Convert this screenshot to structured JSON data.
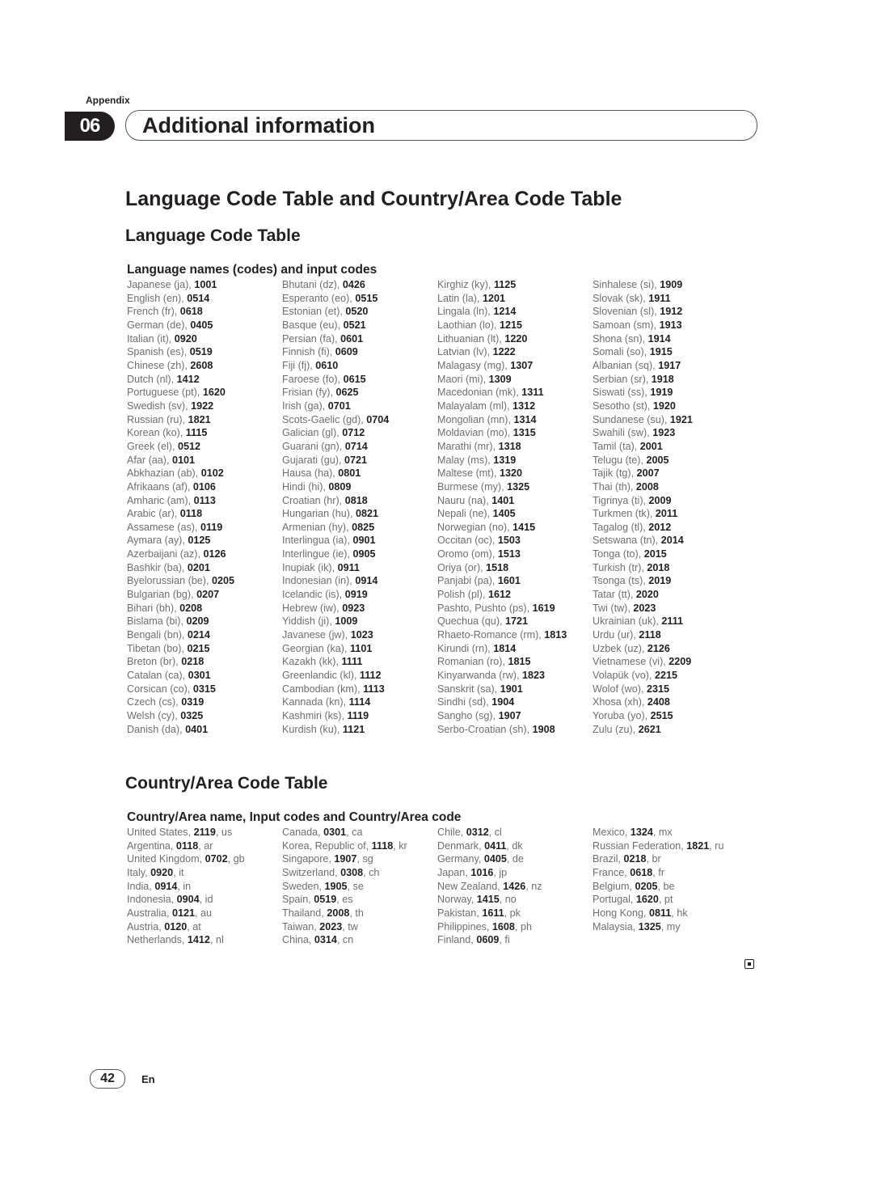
{
  "header": {
    "appendix_label": "Appendix",
    "chapter_number": "06",
    "chapter_title": "Additional information"
  },
  "main_title": "Language Code Table and Country/Area Code Table",
  "language_section": {
    "title": "Language Code Table",
    "subtitle": "Language names (codes) and input codes",
    "columns": [
      [
        {
          "name": "Japanese (ja), ",
          "code": "1001"
        },
        {
          "name": "English (en), ",
          "code": "0514"
        },
        {
          "name": "French (fr), ",
          "code": "0618"
        },
        {
          "name": "German (de), ",
          "code": "0405"
        },
        {
          "name": "Italian (it), ",
          "code": "0920"
        },
        {
          "name": "Spanish (es), ",
          "code": "0519"
        },
        {
          "name": "Chinese (zh), ",
          "code": "2608"
        },
        {
          "name": "Dutch (nl), ",
          "code": "1412"
        },
        {
          "name": "Portuguese (pt), ",
          "code": "1620"
        },
        {
          "name": "Swedish (sv), ",
          "code": "1922"
        },
        {
          "name": "Russian (ru), ",
          "code": "1821"
        },
        {
          "name": "Korean (ko), ",
          "code": "1115"
        },
        {
          "name": "Greek (el), ",
          "code": "0512"
        },
        {
          "name": "Afar (aa), ",
          "code": "0101"
        },
        {
          "name": "Abkhazian (ab), ",
          "code": "0102"
        },
        {
          "name": "Afrikaans (af), ",
          "code": "0106"
        },
        {
          "name": "Amharic (am), ",
          "code": "0113"
        },
        {
          "name": "Arabic (ar), ",
          "code": "0118"
        },
        {
          "name": "Assamese (as), ",
          "code": "0119"
        },
        {
          "name": "Aymara (ay), ",
          "code": "0125"
        },
        {
          "name": "Azerbaijani (az), ",
          "code": "0126"
        },
        {
          "name": "Bashkir (ba), ",
          "code": "0201"
        },
        {
          "name": "Byelorussian (be), ",
          "code": "0205"
        },
        {
          "name": "Bulgarian (bg), ",
          "code": "0207"
        },
        {
          "name": "Bihari (bh), ",
          "code": "0208"
        },
        {
          "name": "Bislama (bi), ",
          "code": "0209"
        },
        {
          "name": "Bengali (bn), ",
          "code": "0214"
        },
        {
          "name": "Tibetan (bo), ",
          "code": "0215"
        },
        {
          "name": "Breton (br), ",
          "code": "0218"
        },
        {
          "name": "Catalan (ca), ",
          "code": "0301"
        },
        {
          "name": "Corsican (co), ",
          "code": "0315"
        },
        {
          "name": "Czech (cs), ",
          "code": "0319"
        },
        {
          "name": "Welsh (cy), ",
          "code": "0325"
        },
        {
          "name": "Danish (da), ",
          "code": "0401"
        }
      ],
      [
        {
          "name": "Bhutani (dz), ",
          "code": "0426"
        },
        {
          "name": "Esperanto (eo), ",
          "code": "0515"
        },
        {
          "name": "Estonian (et), ",
          "code": "0520"
        },
        {
          "name": "Basque (eu), ",
          "code": "0521"
        },
        {
          "name": "Persian (fa), ",
          "code": "0601"
        },
        {
          "name": "Finnish (fi), ",
          "code": "0609"
        },
        {
          "name": "Fiji (fj), ",
          "code": "0610"
        },
        {
          "name": "Faroese (fo), ",
          "code": "0615"
        },
        {
          "name": "Frisian (fy), ",
          "code": "0625"
        },
        {
          "name": "Irish (ga), ",
          "code": "0701"
        },
        {
          "name": "Scots-Gaelic (gd), ",
          "code": "0704"
        },
        {
          "name": "Galician (gl), ",
          "code": "0712"
        },
        {
          "name": "Guarani (gn), ",
          "code": "0714"
        },
        {
          "name": "Gujarati (gu), ",
          "code": "0721"
        },
        {
          "name": "Hausa (ha), ",
          "code": "0801"
        },
        {
          "name": "Hindi (hi), ",
          "code": "0809"
        },
        {
          "name": "Croatian (hr), ",
          "code": "0818"
        },
        {
          "name": "Hungarian (hu), ",
          "code": "0821"
        },
        {
          "name": "Armenian (hy), ",
          "code": "0825"
        },
        {
          "name": "Interlingua (ia), ",
          "code": "0901"
        },
        {
          "name": "Interlingue (ie), ",
          "code": "0905"
        },
        {
          "name": "Inupiak (ik), ",
          "code": "0911"
        },
        {
          "name": "Indonesian (in), ",
          "code": "0914"
        },
        {
          "name": "Icelandic (is), ",
          "code": "0919"
        },
        {
          "name": "Hebrew (iw), ",
          "code": "0923"
        },
        {
          "name": "Yiddish (ji), ",
          "code": "1009"
        },
        {
          "name": "Javanese (jw), ",
          "code": "1023"
        },
        {
          "name": "Georgian (ka), ",
          "code": "1101"
        },
        {
          "name": "Kazakh (kk), ",
          "code": "1111"
        },
        {
          "name": "Greenlandic (kl), ",
          "code": "1112"
        },
        {
          "name": "Cambodian (km), ",
          "code": "1113"
        },
        {
          "name": "Kannada (kn), ",
          "code": "1114"
        },
        {
          "name": "Kashmiri (ks), ",
          "code": "1119"
        },
        {
          "name": "Kurdish (ku), ",
          "code": "1121"
        }
      ],
      [
        {
          "name": "Kirghiz (ky), ",
          "code": "1125"
        },
        {
          "name": "Latin (la), ",
          "code": "1201"
        },
        {
          "name": "Lingala (ln), ",
          "code": "1214"
        },
        {
          "name": "Laothian (lo), ",
          "code": "1215"
        },
        {
          "name": "Lithuanian (lt), ",
          "code": "1220"
        },
        {
          "name": "Latvian (lv), ",
          "code": "1222"
        },
        {
          "name": "Malagasy (mg), ",
          "code": "1307"
        },
        {
          "name": "Maori (mi), ",
          "code": "1309"
        },
        {
          "name": "Macedonian (mk), ",
          "code": "1311"
        },
        {
          "name": "Malayalam (ml), ",
          "code": "1312"
        },
        {
          "name": "Mongolian (mn), ",
          "code": "1314"
        },
        {
          "name": "Moldavian (mo), ",
          "code": "1315"
        },
        {
          "name": "Marathi (mr), ",
          "code": "1318"
        },
        {
          "name": "Malay (ms), ",
          "code": "1319"
        },
        {
          "name": "Maltese (mt), ",
          "code": "1320"
        },
        {
          "name": "Burmese (my), ",
          "code": "1325"
        },
        {
          "name": "Nauru (na), ",
          "code": "1401"
        },
        {
          "name": "Nepali (ne), ",
          "code": "1405"
        },
        {
          "name": "Norwegian (no), ",
          "code": "1415"
        },
        {
          "name": "Occitan (oc), ",
          "code": "1503"
        },
        {
          "name": "Oromo (om), ",
          "code": "1513"
        },
        {
          "name": "Oriya (or), ",
          "code": "1518"
        },
        {
          "name": "Panjabi (pa), ",
          "code": "1601"
        },
        {
          "name": "Polish (pl), ",
          "code": "1612"
        },
        {
          "name": "Pashto, Pushto (ps), ",
          "code": "1619"
        },
        {
          "name": "Quechua (qu), ",
          "code": "1721"
        },
        {
          "name": "Rhaeto-Romance (rm), ",
          "code": "1813"
        },
        {
          "name": "Kirundi (rn), ",
          "code": "1814"
        },
        {
          "name": "Romanian (ro), ",
          "code": "1815"
        },
        {
          "name": "Kinyarwanda (rw), ",
          "code": "1823"
        },
        {
          "name": "Sanskrit (sa), ",
          "code": "1901"
        },
        {
          "name": "Sindhi (sd), ",
          "code": "1904"
        },
        {
          "name": "Sangho (sg), ",
          "code": "1907"
        },
        {
          "name": "Serbo-Croatian (sh), ",
          "code": "1908"
        }
      ],
      [
        {
          "name": "Sinhalese (si), ",
          "code": "1909"
        },
        {
          "name": "Slovak (sk), ",
          "code": "1911"
        },
        {
          "name": "Slovenian (sl), ",
          "code": "1912"
        },
        {
          "name": "Samoan (sm), ",
          "code": "1913"
        },
        {
          "name": "Shona (sn), ",
          "code": "1914"
        },
        {
          "name": "Somali (so), ",
          "code": "1915"
        },
        {
          "name": "Albanian (sq), ",
          "code": "1917"
        },
        {
          "name": "Serbian (sr), ",
          "code": "1918"
        },
        {
          "name": "Siswati (ss), ",
          "code": "1919"
        },
        {
          "name": "Sesotho (st), ",
          "code": "1920"
        },
        {
          "name": "Sundanese (su), ",
          "code": "1921"
        },
        {
          "name": "Swahili (sw), ",
          "code": "1923"
        },
        {
          "name": "Tamil (ta), ",
          "code": "2001"
        },
        {
          "name": "Telugu (te), ",
          "code": "2005"
        },
        {
          "name": "Tajik (tg), ",
          "code": "2007"
        },
        {
          "name": "Thai (th), ",
          "code": "2008"
        },
        {
          "name": "Tigrinya (ti), ",
          "code": "2009"
        },
        {
          "name": "Turkmen (tk), ",
          "code": "2011"
        },
        {
          "name": "Tagalog (tl), ",
          "code": "2012"
        },
        {
          "name": "Setswana (tn), ",
          "code": "2014"
        },
        {
          "name": "Tonga (to), ",
          "code": "2015"
        },
        {
          "name": "Turkish (tr), ",
          "code": "2018"
        },
        {
          "name": "Tsonga (ts), ",
          "code": "2019"
        },
        {
          "name": "Tatar (tt), ",
          "code": "2020"
        },
        {
          "name": "Twi (tw), ",
          "code": "2023"
        },
        {
          "name": "Ukrainian (uk), ",
          "code": "2111"
        },
        {
          "name": "Urdu (ur), ",
          "code": "2118"
        },
        {
          "name": "Uzbek (uz), ",
          "code": "2126"
        },
        {
          "name": "Vietnamese (vi), ",
          "code": "2209"
        },
        {
          "name": "Volapük (vo), ",
          "code": "2215"
        },
        {
          "name": "Wolof (wo), ",
          "code": "2315"
        },
        {
          "name": "Xhosa (xh), ",
          "code": "2408"
        },
        {
          "name": "Yoruba (yo), ",
          "code": "2515"
        },
        {
          "name": "Zulu (zu), ",
          "code": "2621"
        }
      ]
    ]
  },
  "country_section": {
    "title": "Country/Area Code Table",
    "subtitle": "Country/Area name, Input codes and Country/Area code",
    "columns": [
      [
        {
          "name": "United States, ",
          "code": "2119",
          "abbr": ", us"
        },
        {
          "name": "Argentina, ",
          "code": "0118",
          "abbr": ", ar"
        },
        {
          "name": "United Kingdom, ",
          "code": "0702",
          "abbr": ", gb"
        },
        {
          "name": "Italy, ",
          "code": "0920",
          "abbr": ", it"
        },
        {
          "name": "India, ",
          "code": "0914",
          "abbr": ", in"
        },
        {
          "name": "Indonesia, ",
          "code": "0904",
          "abbr": ", id"
        },
        {
          "name": "Australia, ",
          "code": "0121",
          "abbr": ", au"
        },
        {
          "name": "Austria, ",
          "code": "0120",
          "abbr": ", at"
        },
        {
          "name": "Netherlands, ",
          "code": "1412",
          "abbr": ", nl"
        }
      ],
      [
        {
          "name": "Canada, ",
          "code": "0301",
          "abbr": ", ca"
        },
        {
          "name": "Korea, Republic of, ",
          "code": "1118",
          "abbr": ", kr"
        },
        {
          "name": "Singapore, ",
          "code": "1907",
          "abbr": ", sg"
        },
        {
          "name": "Switzerland, ",
          "code": "0308",
          "abbr": ", ch"
        },
        {
          "name": "Sweden, ",
          "code": "1905",
          "abbr": ", se"
        },
        {
          "name": "Spain, ",
          "code": "0519",
          "abbr": ", es"
        },
        {
          "name": "Thailand, ",
          "code": "2008",
          "abbr": ", th"
        },
        {
          "name": "Taiwan, ",
          "code": "2023",
          "abbr": ", tw"
        },
        {
          "name": "China, ",
          "code": "0314",
          "abbr": ", cn"
        }
      ],
      [
        {
          "name": "Chile, ",
          "code": "0312",
          "abbr": ", cl"
        },
        {
          "name": "Denmark, ",
          "code": "0411",
          "abbr": ", dk"
        },
        {
          "name": "Germany, ",
          "code": "0405",
          "abbr": ", de"
        },
        {
          "name": "Japan, ",
          "code": "1016",
          "abbr": ", jp"
        },
        {
          "name": "New Zealand, ",
          "code": "1426",
          "abbr": ", nz"
        },
        {
          "name": "Norway, ",
          "code": "1415",
          "abbr": ", no"
        },
        {
          "name": "Pakistan, ",
          "code": "1611",
          "abbr": ", pk"
        },
        {
          "name": "Philippines, ",
          "code": "1608",
          "abbr": ", ph"
        },
        {
          "name": "Finland, ",
          "code": "0609",
          "abbr": ", fi"
        }
      ],
      [
        {
          "name": "Mexico, ",
          "code": "1324",
          "abbr": ", mx"
        },
        {
          "name": "Russian Federation, ",
          "code": "1821",
          "abbr": ", ru"
        },
        {
          "name": "Brazil, ",
          "code": "0218",
          "abbr": ", br"
        },
        {
          "name": "France, ",
          "code": "0618",
          "abbr": ", fr"
        },
        {
          "name": "Belgium, ",
          "code": "0205",
          "abbr": ", be"
        },
        {
          "name": "Portugal, ",
          "code": "1620",
          "abbr": ", pt"
        },
        {
          "name": "Hong Kong, ",
          "code": "0811",
          "abbr": ", hk"
        },
        {
          "name": "Malaysia, ",
          "code": "1325",
          "abbr": ", my"
        }
      ]
    ]
  },
  "footer": {
    "end_mark_icon": "end-of-section-icon",
    "page_number": "42",
    "language": "En"
  }
}
